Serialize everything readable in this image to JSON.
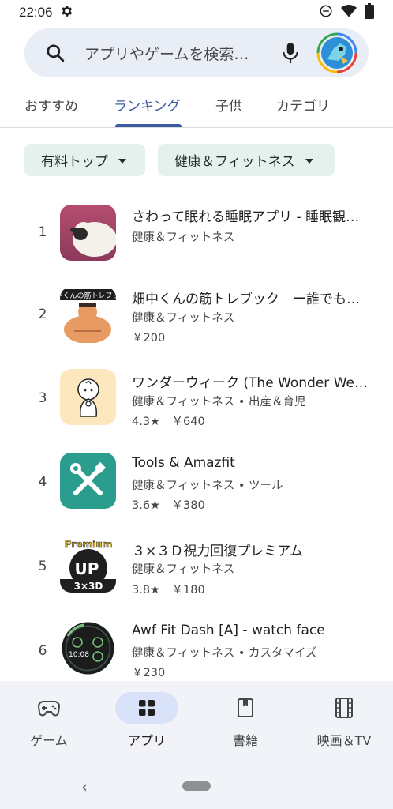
{
  "status": {
    "time": "22:06"
  },
  "search": {
    "placeholder": "アプリやゲームを検索…"
  },
  "tabs": [
    {
      "label": "おすすめ"
    },
    {
      "label": "ランキング"
    },
    {
      "label": "子供"
    },
    {
      "label": "カテゴリ"
    }
  ],
  "filters": [
    {
      "label": "有料トップ"
    },
    {
      "label": "健康＆フィットネス"
    }
  ],
  "apps": [
    {
      "rank": "1",
      "title": "さわって眠れる睡眠アプリ - 睡眠観…",
      "category": "健康＆フィットネス",
      "meta": ""
    },
    {
      "rank": "2",
      "title": "畑中くんの筋トレブック　ー誰でも…",
      "category": "健康＆フィットネス",
      "meta": "￥200"
    },
    {
      "rank": "3",
      "title": "ワンダーウィーク (The Wonder We…",
      "category": "健康＆フィットネス • 出産＆育児",
      "meta": "4.3★　￥640"
    },
    {
      "rank": "4",
      "title": "Tools & Amazfit",
      "category": "健康＆フィットネス • ツール",
      "meta": "3.6★　￥380"
    },
    {
      "rank": "5",
      "title": "３×３Ｄ視力回復プレミアム",
      "category": "健康＆フィットネス",
      "meta": "3.8★　￥180"
    },
    {
      "rank": "6",
      "title": "Awf Fit Dash [A] - watch face",
      "category": "健康＆フィットネス • カスタマイズ",
      "meta": "￥230"
    }
  ],
  "icon_text": {
    "app2": "畑中くんの筋トレブック",
    "app5_top": "Premium",
    "app5_mid": "UP",
    "app5_bot": "3×3D",
    "app6_time": "10:08"
  },
  "nav": [
    {
      "label": "ゲーム",
      "icon": "gamepad-icon"
    },
    {
      "label": "アプリ",
      "icon": "apps-grid-icon"
    },
    {
      "label": "書籍",
      "icon": "book-icon"
    },
    {
      "label": "映画＆TV",
      "icon": "film-icon"
    }
  ],
  "colors": {
    "accent": "#3a5ba0",
    "chip_bg": "#e4f1ec",
    "nav_bg": "#f1f3f8",
    "search_bg": "#e9eef6"
  }
}
